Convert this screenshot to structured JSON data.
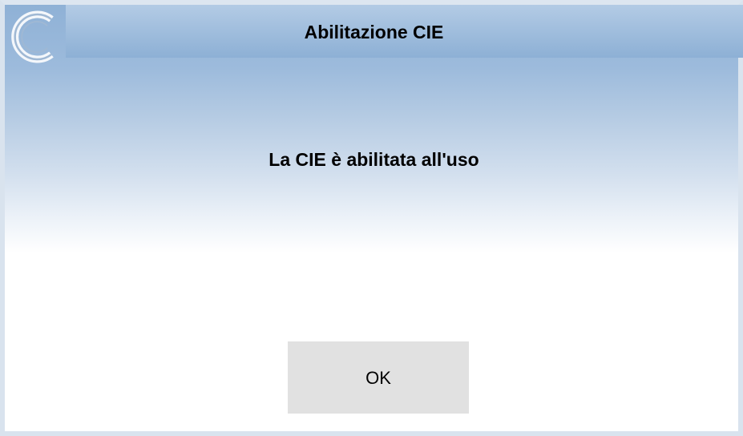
{
  "dialog": {
    "title": "Abilitazione CIE",
    "message": "La CIE è abilitata all'uso",
    "ok_label": "OK",
    "logo_icon": "cie-c-logo-icon"
  },
  "colors": {
    "header_blue": "#8fb1d6",
    "button_gray": "#e1e1e1"
  }
}
